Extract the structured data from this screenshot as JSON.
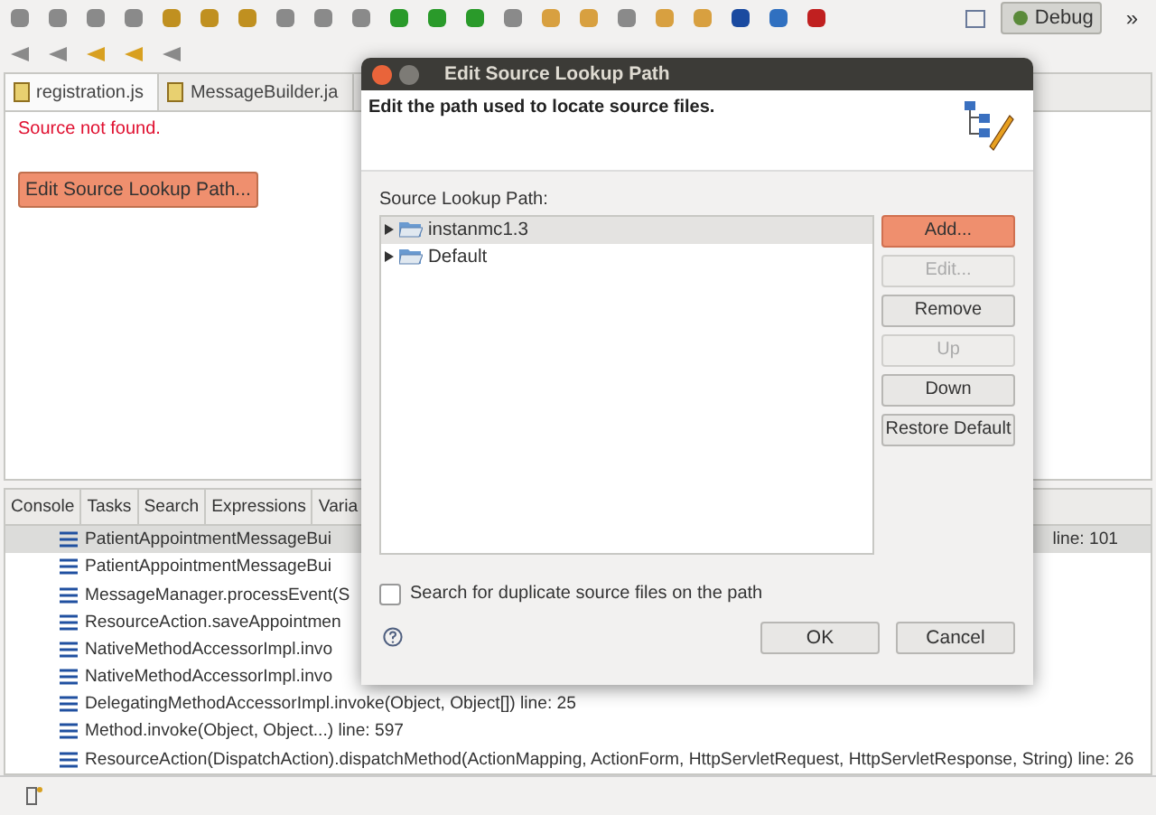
{
  "toolbar": {
    "perspective_button": {
      "label": "Debug",
      "selected": true
    },
    "overflow": "»"
  },
  "editor": {
    "tabs": [
      {
        "label": "registration.js",
        "selected": true
      },
      {
        "label": "MessageBuilder.ja",
        "selected": false
      }
    ],
    "message": "Source not found.",
    "button": "Edit Source Lookup Path..."
  },
  "bottom_panel": {
    "tabs": [
      "Console",
      "Tasks",
      "Search",
      "Expressions",
      "Varia"
    ],
    "frames": [
      {
        "text": "PatientAppointmentMessageBui",
        "suffix": "line: 101",
        "selected": true
      },
      {
        "text": "PatientAppointmentMessageBui",
        "selected": false
      },
      {
        "text": "MessageManager.processEvent(S",
        "selected": false
      },
      {
        "text": "ResourceAction.saveAppointmen",
        "selected": false
      },
      {
        "text": "NativeMethodAccessorImpl.invo",
        "selected": false
      },
      {
        "text": "NativeMethodAccessorImpl.invo",
        "selected": false
      },
      {
        "text": "DelegatingMethodAccessorImpl.invoke(Object, Object[]) line: 25",
        "selected": false
      },
      {
        "text": "Method.invoke(Object, Object...) line: 597",
        "selected": false
      },
      {
        "text": "ResourceAction(DispatchAction).dispatchMethod(ActionMapping, ActionForm, HttpServletRequest, HttpServletResponse, String) line: 26",
        "selected": false
      }
    ]
  },
  "dialog": {
    "title": "Edit Source Lookup Path",
    "heading": "Edit the path used to locate source files.",
    "list_label": "Source Lookup Path:",
    "entries": [
      {
        "label": "instanmc1.3",
        "selected": true
      },
      {
        "label": "Default",
        "selected": false
      }
    ],
    "side_buttons": [
      {
        "label": "Add...",
        "disabled": false,
        "focused": true
      },
      {
        "label": "Edit...",
        "disabled": true,
        "focused": false
      },
      {
        "label": "Remove",
        "disabled": false,
        "focused": false
      },
      {
        "label": "Up",
        "disabled": true,
        "focused": false
      },
      {
        "label": "Down",
        "disabled": false,
        "focused": false
      },
      {
        "label": "Restore Default",
        "disabled": false,
        "focused": false
      }
    ],
    "checkbox": {
      "label": "Search for duplicate source files on the path",
      "checked": false
    },
    "buttons": [
      "OK",
      "Cancel"
    ]
  }
}
